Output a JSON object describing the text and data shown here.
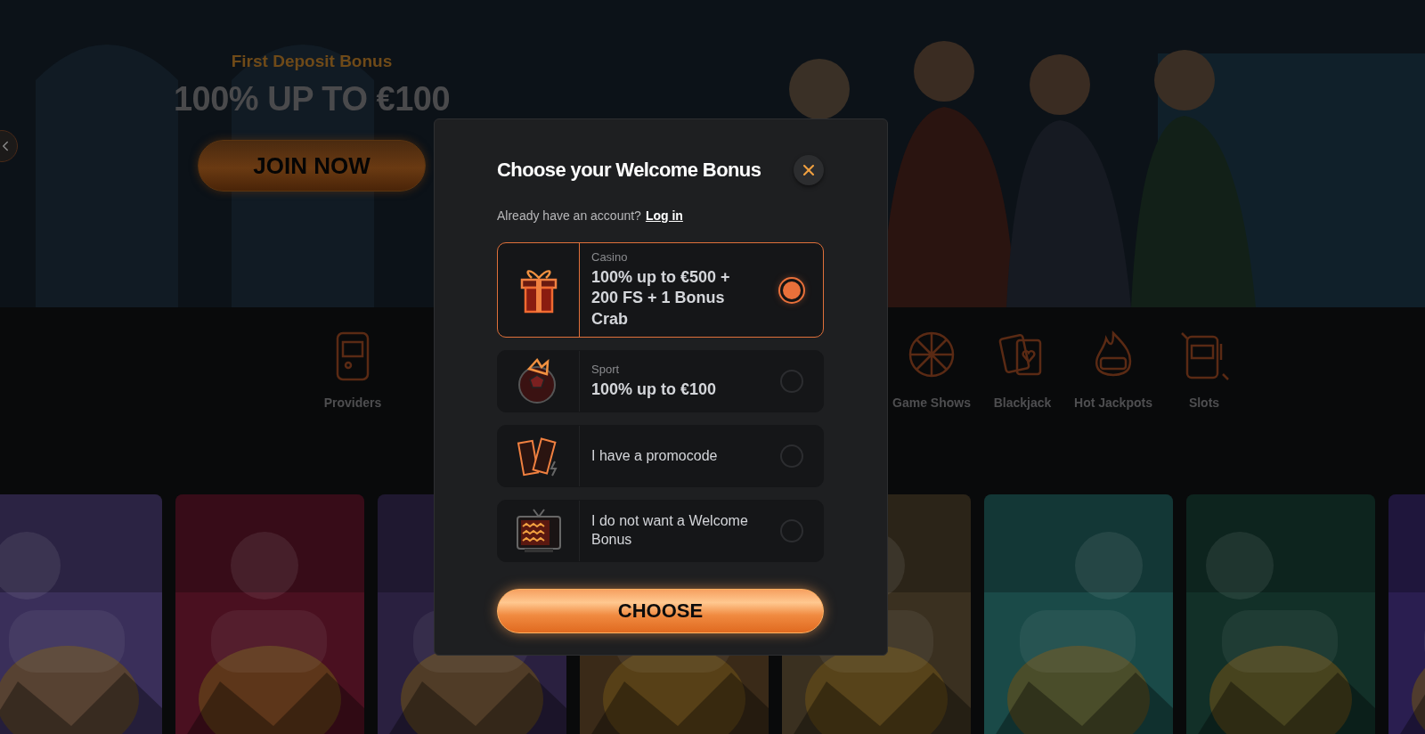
{
  "banner": {
    "subtitle": "First Deposit Bonus",
    "headline": "100% UP TO €100",
    "button": "JOIN NOW"
  },
  "categories": [
    {
      "label": "Providers",
      "kind": "arcade"
    },
    {
      "label": "Game Shows",
      "kind": "wheel"
    },
    {
      "label": "Blackjack",
      "kind": "cards"
    },
    {
      "label": "Hot Jackpots",
      "kind": "flame"
    },
    {
      "label": "Slots",
      "kind": "slot"
    }
  ],
  "modal": {
    "title": "Choose your Welcome Bonus",
    "account_prompt": "Already have an account?",
    "login_link": "Log in",
    "options": [
      {
        "kind": "casino",
        "category": "Casino",
        "offer": "100% up to €500 + 200 FS + 1 Bonus Crab",
        "selected": true
      },
      {
        "kind": "sport",
        "category": "Sport",
        "offer": "100% up to €100",
        "selected": false
      },
      {
        "kind": "promocode",
        "offer": "I have a promocode",
        "selected": false
      },
      {
        "kind": "none",
        "offer": "I do not want a Welcome Bonus",
        "selected": false
      }
    ],
    "button": "CHOOSE"
  }
}
